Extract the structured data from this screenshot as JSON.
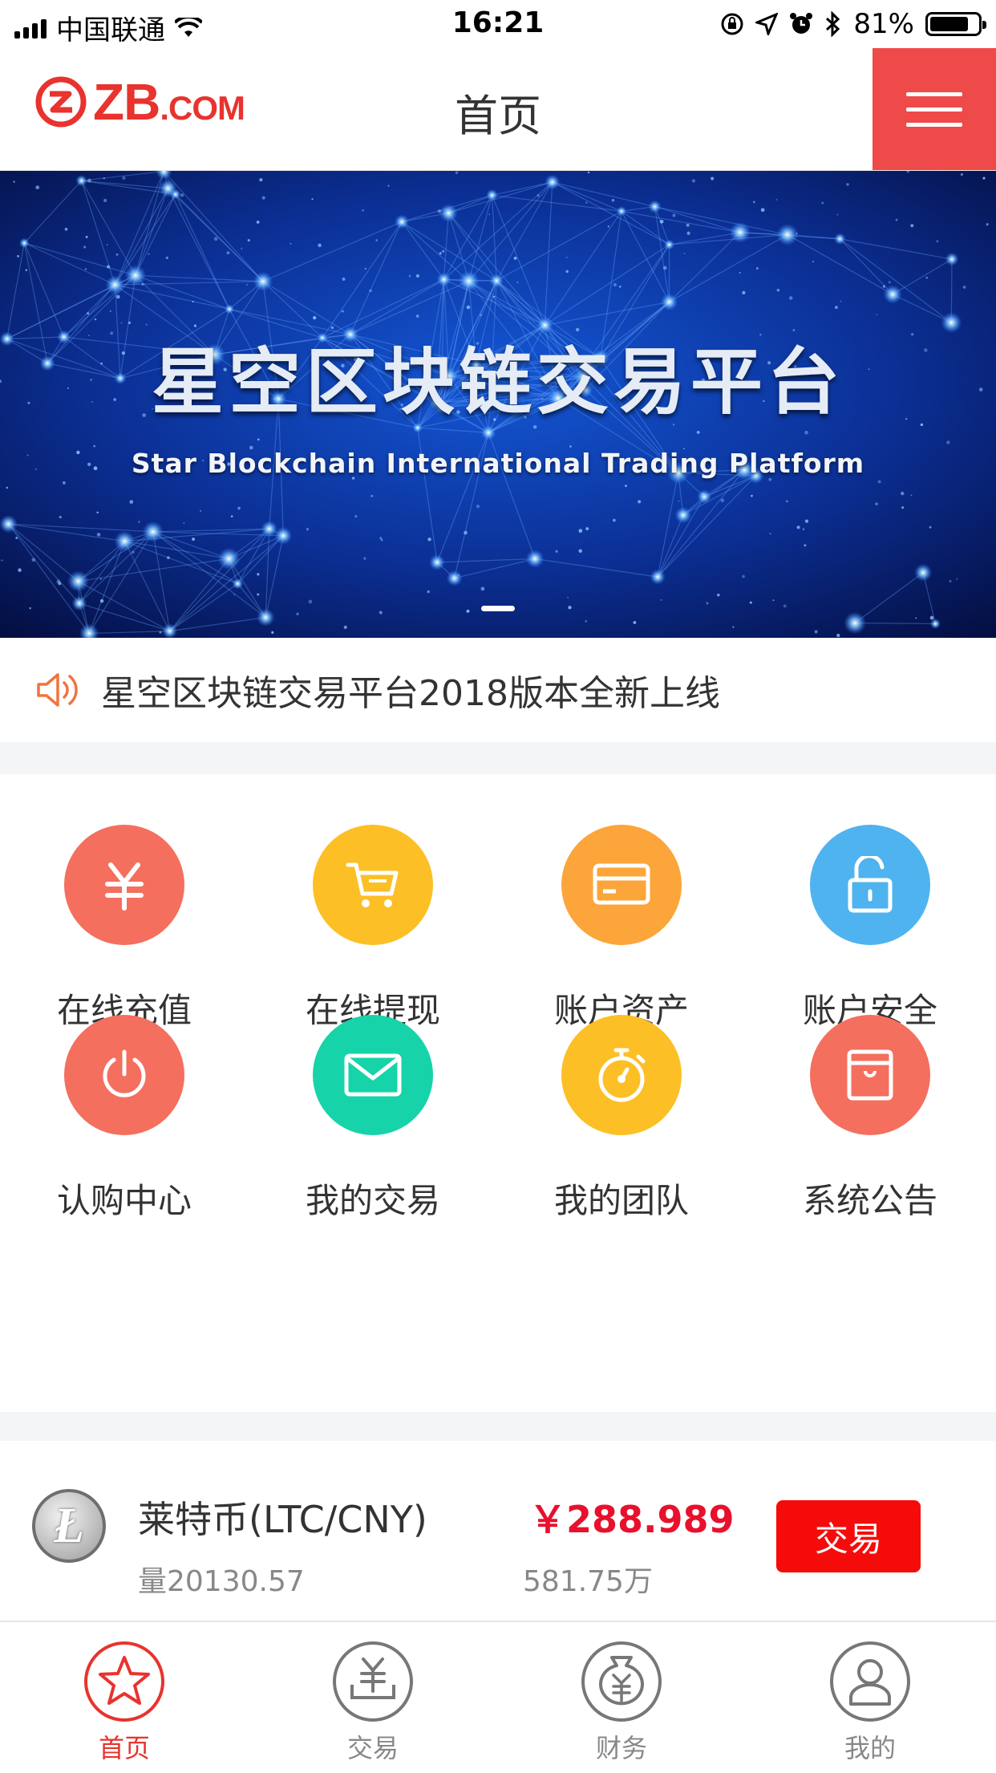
{
  "status_bar": {
    "carrier": "中国联通",
    "time": "16:21",
    "battery": "81%",
    "battery_level": 0.81
  },
  "header": {
    "logo_text_big": "ZB",
    "logo_text_small": ".COM",
    "title": "首页",
    "menu_icon": "hamburger-icon"
  },
  "banner": {
    "title": "星空区块链交易平台",
    "subtitle": "Star Blockchain International Trading Platform",
    "slides": 1,
    "active_slide": 1
  },
  "notice": {
    "icon": "speaker-icon",
    "text": "星空区块链交易平台2018版本全新上线"
  },
  "shortcuts": [
    {
      "label": "在线充值",
      "icon": "yuan-icon",
      "color": "#f46f5e"
    },
    {
      "label": "在线提现",
      "icon": "cart-icon",
      "color": "#fcbf25"
    },
    {
      "label": "账户资产",
      "icon": "card-icon",
      "color": "#fca53a"
    },
    {
      "label": "账户安全",
      "icon": "unlock-icon",
      "color": "#4fb3ef"
    },
    {
      "label": "认购中心",
      "icon": "power-icon",
      "color": "#f46f5e"
    },
    {
      "label": "我的交易",
      "icon": "mail-icon",
      "color": "#17d3a9"
    },
    {
      "label": "我的团队",
      "icon": "stopwatch-icon",
      "color": "#fcbf25"
    },
    {
      "label": "系统公告",
      "icon": "notice-icon",
      "color": "#f46f5e"
    }
  ],
  "market": {
    "coin_icon": "litecoin-icon",
    "coin_symbol": "Ł",
    "name": "莱特币(LTC/CNY)",
    "volume": "量20130.57",
    "price": "￥288.989",
    "cny_volume": "581.75万",
    "trade_label": "交易"
  },
  "tabs": [
    {
      "label": "首页",
      "icon": "star-icon",
      "active": true
    },
    {
      "label": "交易",
      "icon": "yuan-tray-icon",
      "active": false
    },
    {
      "label": "财务",
      "icon": "money-bag-icon",
      "active": false
    },
    {
      "label": "我的",
      "icon": "user-icon",
      "active": false
    }
  ],
  "colors": {
    "brand_red": "#e8332e",
    "menu_red": "#ef4a4a",
    "price_red": "#e8112d",
    "button_red": "#f60b0b"
  }
}
